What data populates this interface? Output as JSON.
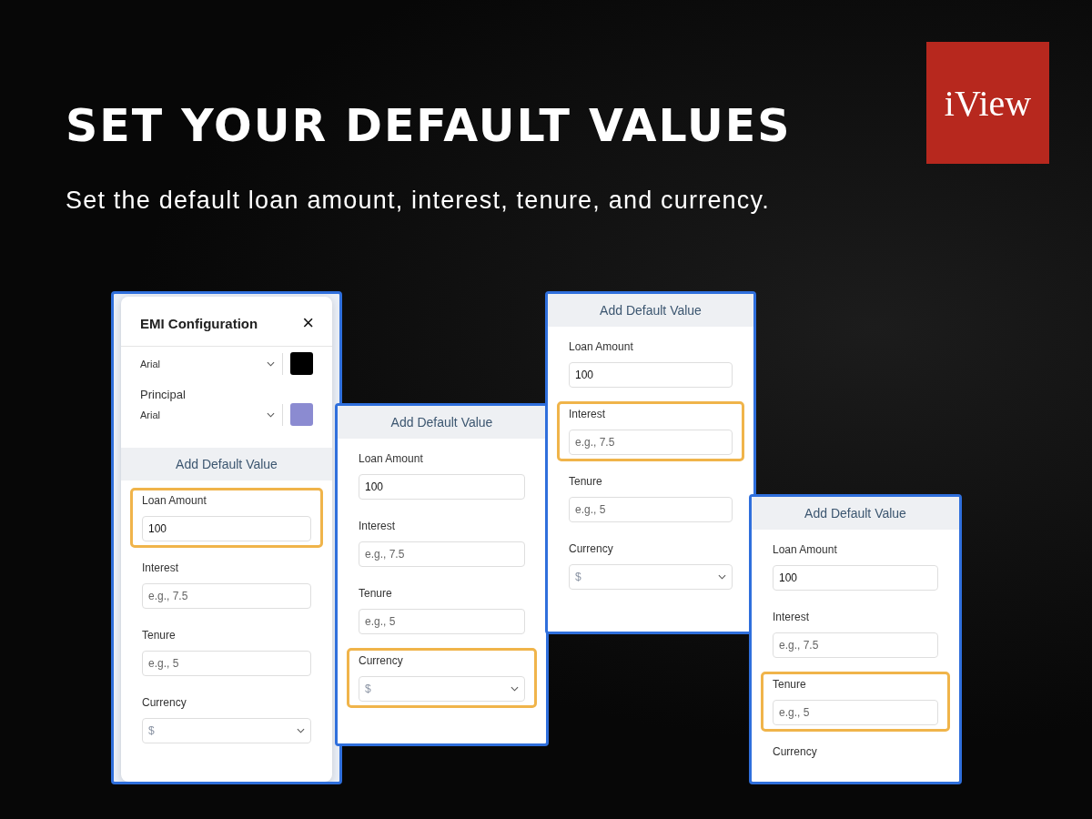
{
  "heading": "SET YOUR DEFAULT VALUES",
  "subheading": "Set the default loan amount, interest, tenure, and currency.",
  "logo": {
    "text": "iView"
  },
  "panels": [
    {
      "header": {
        "title": "EMI Configuration",
        "close": "×"
      },
      "font_rows": [
        {
          "font": "Arial",
          "color": "#000000"
        },
        {
          "label": "Principal",
          "font": "Arial",
          "color": "#8b8bd1"
        }
      ],
      "section_title": "Add Default Value",
      "fields": [
        {
          "kind": "input",
          "label": "Loan Amount",
          "value": "100",
          "highlighted": true
        },
        {
          "kind": "input",
          "label": "Interest",
          "placeholder": "e.g., 7.5",
          "highlighted": false
        },
        {
          "kind": "input",
          "label": "Tenure",
          "placeholder": "e.g., 5",
          "highlighted": false
        },
        {
          "kind": "select",
          "label": "Currency",
          "placeholder": "$",
          "highlighted": false
        }
      ]
    },
    {
      "section_title": "Add Default Value",
      "fields": [
        {
          "kind": "input",
          "label": "Loan Amount",
          "value": "100",
          "highlighted": false
        },
        {
          "kind": "input",
          "label": "Interest",
          "placeholder": "e.g., 7.5",
          "highlighted": false
        },
        {
          "kind": "input",
          "label": "Tenure",
          "placeholder": "e.g., 5",
          "highlighted": false
        },
        {
          "kind": "select",
          "label": "Currency",
          "placeholder": "$",
          "highlighted": true
        }
      ]
    },
    {
      "section_title": "Add Default Value",
      "fields": [
        {
          "kind": "input",
          "label": "Loan Amount",
          "value": "100",
          "highlighted": false
        },
        {
          "kind": "input",
          "label": "Interest",
          "placeholder": "e.g., 7.5",
          "highlighted": true
        },
        {
          "kind": "input",
          "label": "Tenure",
          "placeholder": "e.g., 5",
          "highlighted": false
        },
        {
          "kind": "select",
          "label": "Currency",
          "placeholder": "$",
          "highlighted": false
        }
      ]
    },
    {
      "section_title": "Add Default Value",
      "fields": [
        {
          "kind": "input",
          "label": "Loan Amount",
          "value": "100",
          "highlighted": false
        },
        {
          "kind": "input",
          "label": "Interest",
          "placeholder": "e.g., 7.5",
          "highlighted": false
        },
        {
          "kind": "input",
          "label": "Tenure",
          "placeholder": "e.g., 5",
          "highlighted": true
        },
        {
          "kind": "label",
          "label": "Currency",
          "highlighted": false
        }
      ]
    }
  ]
}
